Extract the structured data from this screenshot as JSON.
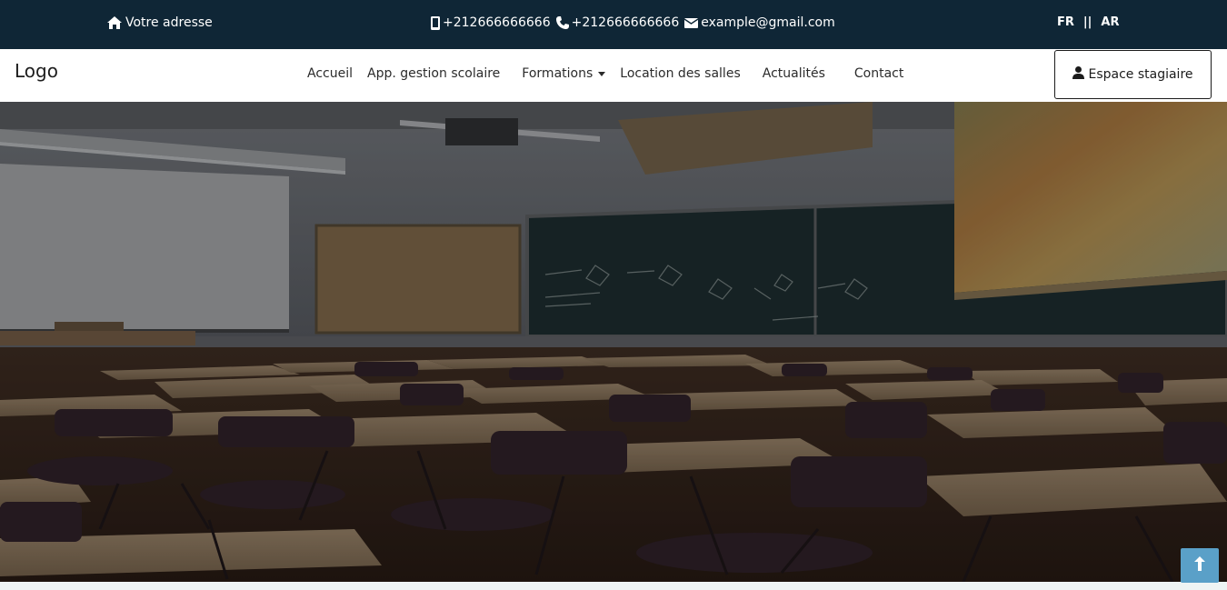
{
  "topbar": {
    "address": "Votre adresse",
    "mobile": "+212666666666",
    "phone": "+212666666666",
    "email": "example@gmail.com",
    "lang_fr": "FR",
    "lang_sep": "||",
    "lang_ar": "AR"
  },
  "nav": {
    "logo": "Logo",
    "items": [
      "Accueil",
      "App. gestion scolaire",
      "Formations",
      "Location des salles",
      "Actualités",
      "Contact"
    ],
    "espace": "Espace stagiaire"
  },
  "colors": {
    "topbar_bg": "#0f2636",
    "scroll_top_bg": "#5aa0c8"
  },
  "icons": [
    "home-icon",
    "mobile-icon",
    "phone-icon",
    "envelope-icon",
    "chevron-down-icon",
    "user-icon",
    "arrow-up-icon"
  ]
}
